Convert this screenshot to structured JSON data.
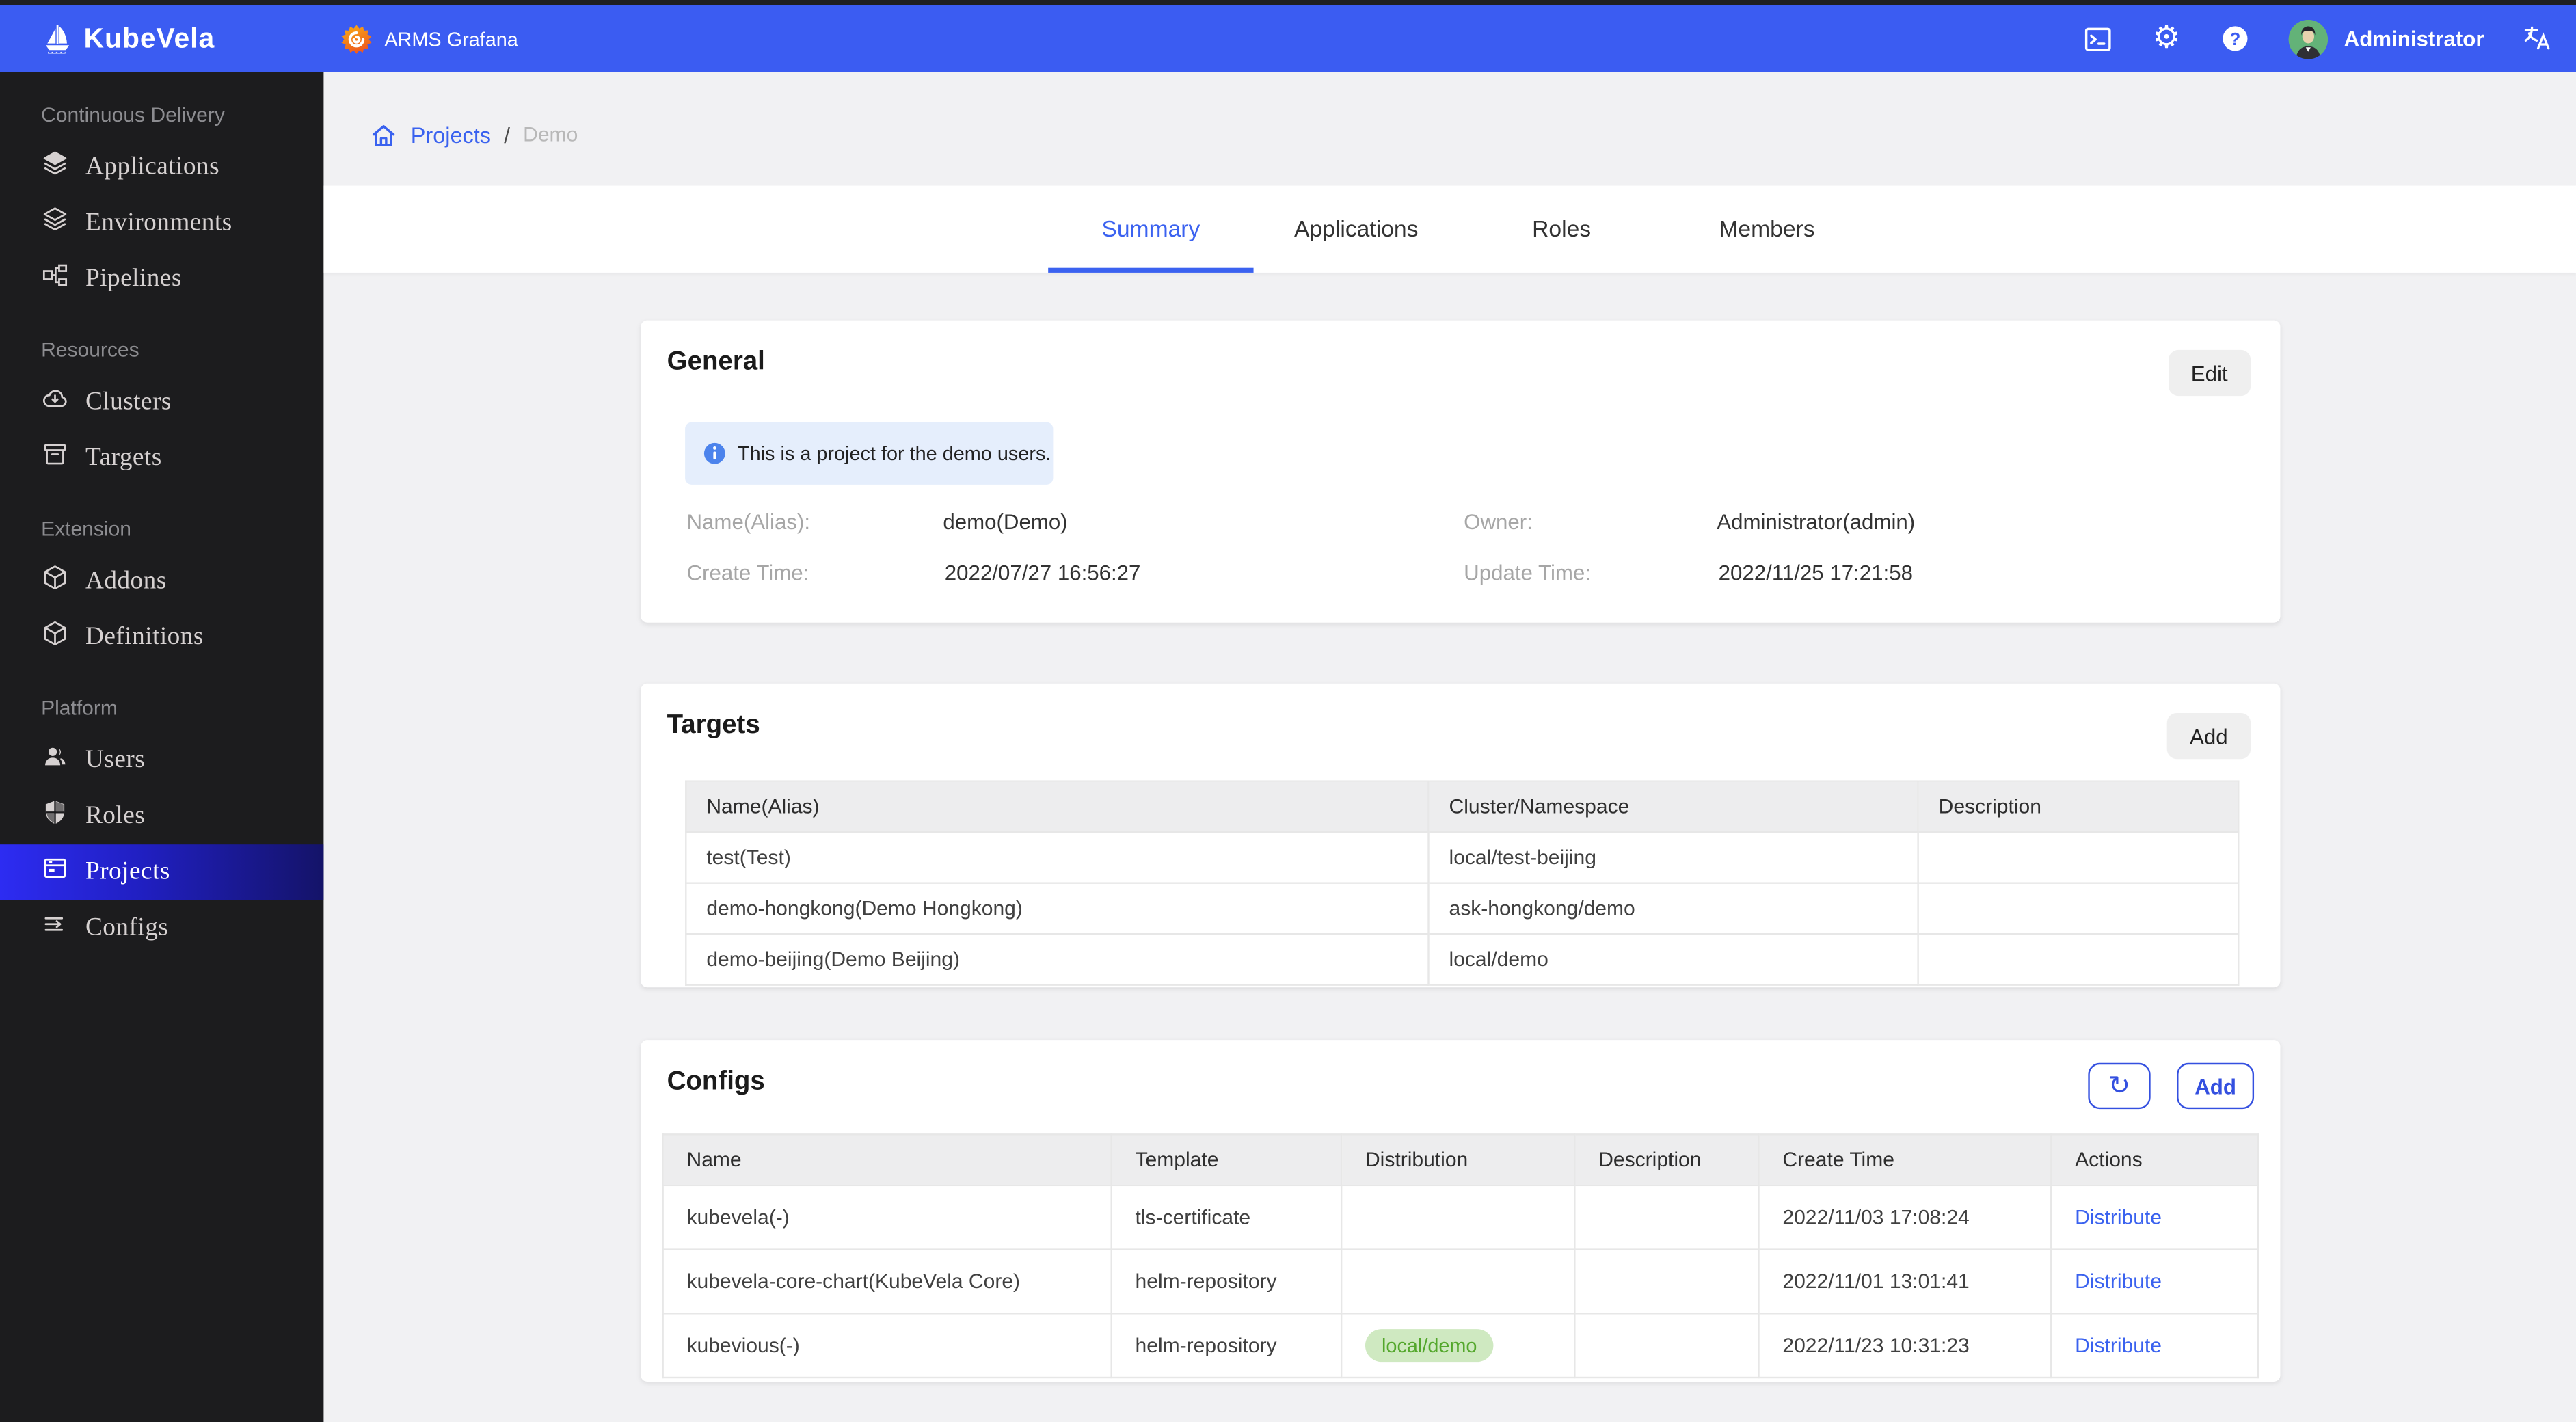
{
  "topbar": {
    "brand": "KubeVela",
    "grafana_label": "ARMS Grafana",
    "user": "Administrator"
  },
  "sidebar": {
    "groups": [
      {
        "label": "Continuous Delivery",
        "items": [
          {
            "label": "Applications",
            "icon": "layers-icon"
          },
          {
            "label": "Environments",
            "icon": "layers-outline-icon"
          },
          {
            "label": "Pipelines",
            "icon": "pipeline-icon"
          }
        ]
      },
      {
        "label": "Resources",
        "items": [
          {
            "label": "Clusters",
            "icon": "cloud-download-icon"
          },
          {
            "label": "Targets",
            "icon": "archive-icon"
          }
        ]
      },
      {
        "label": "Extension",
        "items": [
          {
            "label": "Addons",
            "icon": "cube-icon"
          },
          {
            "label": "Definitions",
            "icon": "cube-icon"
          }
        ]
      },
      {
        "label": "Platform",
        "items": [
          {
            "label": "Users",
            "icon": "users-icon"
          },
          {
            "label": "Roles",
            "icon": "shield-icon"
          },
          {
            "label": "Projects",
            "icon": "project-icon",
            "active": true
          },
          {
            "label": "Configs",
            "icon": "config-list-icon"
          }
        ]
      }
    ]
  },
  "breadcrumb": {
    "root": "Projects",
    "separator": "/",
    "current": "Demo"
  },
  "tabs": [
    {
      "label": "Summary",
      "active": true
    },
    {
      "label": "Applications"
    },
    {
      "label": "Roles"
    },
    {
      "label": "Members"
    }
  ],
  "general": {
    "title": "General",
    "edit_label": "Edit",
    "alert": "This is a project for the demo users.",
    "fields": {
      "name_label": "Name(Alias):",
      "name_value": "demo(Demo)",
      "owner_label": "Owner:",
      "owner_value": "Administrator(admin)",
      "create_label": "Create Time:",
      "create_value": "2022/07/27 16:56:27",
      "update_label": "Update Time:",
      "update_value": "2022/11/25 17:21:58"
    }
  },
  "targets": {
    "title": "Targets",
    "add_label": "Add",
    "headers": [
      "Name(Alias)",
      "Cluster/Namespace",
      "Description"
    ],
    "rows": [
      {
        "name": "test(Test)",
        "cluster": "local/test-beijing",
        "description": ""
      },
      {
        "name": "demo-hongkong(Demo Hongkong)",
        "cluster": "ask-hongkong/demo",
        "description": ""
      },
      {
        "name": "demo-beijing(Demo Beijing)",
        "cluster": "local/demo",
        "description": ""
      }
    ]
  },
  "configs": {
    "title": "Configs",
    "add_label": "Add",
    "refresh_glyph": "↻",
    "headers": [
      "Name",
      "Template",
      "Distribution",
      "Description",
      "Create Time",
      "Actions"
    ],
    "rows": [
      {
        "name": "kubevela(-)",
        "template": "tls-certificate",
        "distribution_badge": "",
        "description": "",
        "create_time": "2022/11/03 17:08:24",
        "action": "Distribute"
      },
      {
        "name": "kubevela-core-chart(KubeVela Core)",
        "template": "helm-repository",
        "distribution_badge": "",
        "description": "",
        "create_time": "2022/11/01 13:01:41",
        "action": "Distribute"
      },
      {
        "name": "kubevious(-)",
        "template": "helm-repository",
        "distribution_badge": "local/demo",
        "description": "",
        "create_time": "2022/11/23 10:31:23",
        "action": "Distribute"
      }
    ]
  },
  "colors": {
    "topbar_blue": "#3b5cf2",
    "link_blue": "#3a62ef",
    "active_tab_blue": "#3b62f0",
    "badge_bg": "#cfe9c1",
    "badge_text": "#53a72b",
    "sidebar_bg": "#1c1c1e",
    "alert_bg": "#e5eefc"
  }
}
